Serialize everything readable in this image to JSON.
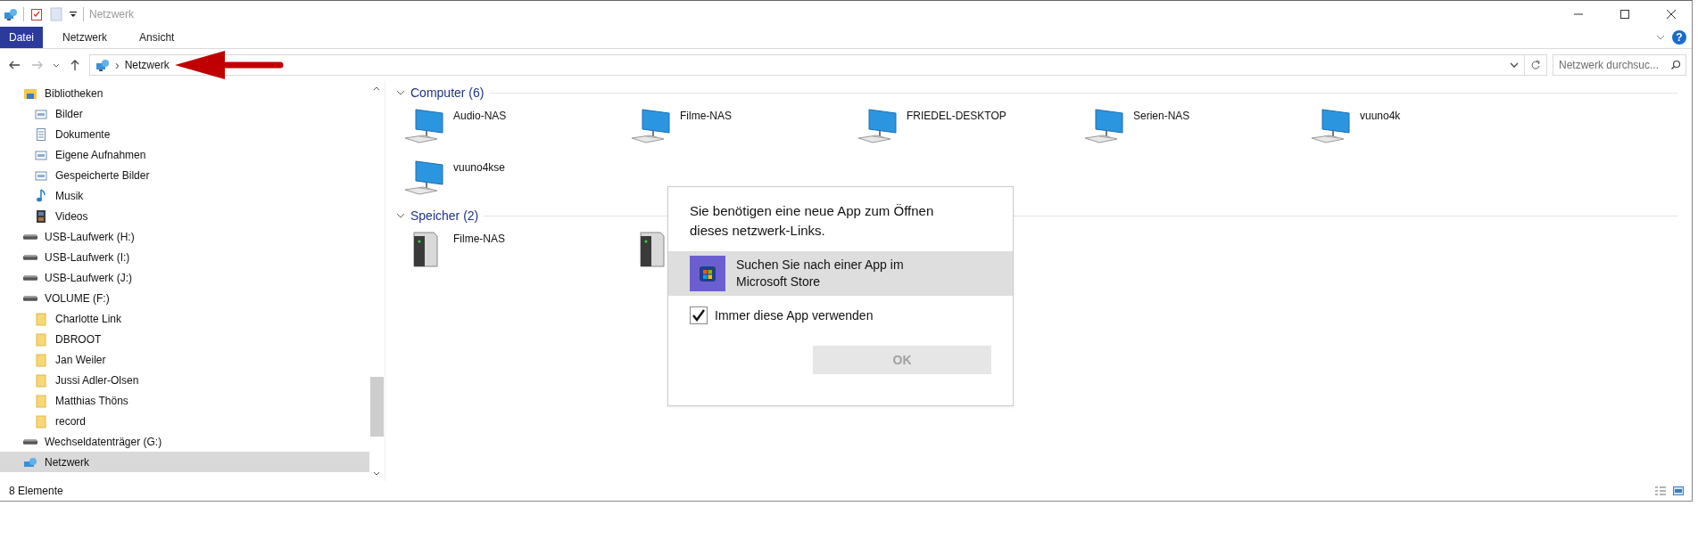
{
  "window": {
    "title": "Netzwerk"
  },
  "ribbon": {
    "tabs": [
      {
        "label": "Datei",
        "selected": true
      },
      {
        "label": "Netzwerk",
        "selected": false
      },
      {
        "label": "Ansicht",
        "selected": false
      }
    ],
    "help_glyph": "?"
  },
  "address": {
    "separator": "›",
    "path": "Netzwerk"
  },
  "search": {
    "placeholder": "Netzwerk durchsuc..."
  },
  "sidebar": {
    "items": [
      {
        "label": "Bibliotheken",
        "kind": "library",
        "selected": false,
        "children": [
          {
            "label": "Bilder",
            "kind": "pictures",
            "selected": false
          },
          {
            "label": "Dokumente",
            "kind": "documents",
            "selected": false
          },
          {
            "label": "Eigene Aufnahmen",
            "kind": "pictures",
            "selected": false
          },
          {
            "label": "Gespeicherte Bilder",
            "kind": "pictures",
            "selected": false
          },
          {
            "label": "Musik",
            "kind": "music",
            "selected": false
          },
          {
            "label": "Videos",
            "kind": "videos",
            "selected": false
          }
        ]
      },
      {
        "label": "USB-Laufwerk (H:)",
        "kind": "drive",
        "selected": false
      },
      {
        "label": "USB-Laufwerk (I:)",
        "kind": "drive",
        "selected": false
      },
      {
        "label": "USB-Laufwerk (J:)",
        "kind": "drive",
        "selected": false
      },
      {
        "label": "VOLUME (F:)",
        "kind": "drive",
        "selected": false,
        "children": [
          {
            "label": "Charlotte Link",
            "kind": "folder",
            "selected": false
          },
          {
            "label": "DBROOT",
            "kind": "folder",
            "selected": false
          },
          {
            "label": "Jan Weiler",
            "kind": "folder",
            "selected": false
          },
          {
            "label": "Jussi Adler-Olsen",
            "kind": "folder",
            "selected": false
          },
          {
            "label": "Matthias Thöns",
            "kind": "folder",
            "selected": false
          },
          {
            "label": "record",
            "kind": "folder",
            "selected": false
          }
        ]
      },
      {
        "label": "Wechseldatenträger (G:)",
        "kind": "drive",
        "selected": false
      },
      {
        "label": "Netzwerk",
        "kind": "network",
        "selected": true
      }
    ]
  },
  "groups": [
    {
      "title": "Computer (6)",
      "items": [
        {
          "name": "Audio-NAS",
          "kind": "computer"
        },
        {
          "name": "Filme-NAS",
          "kind": "computer"
        },
        {
          "name": "FRIEDEL-DESKTOP",
          "kind": "computer"
        },
        {
          "name": "Serien-NAS",
          "kind": "computer"
        },
        {
          "name": "vuuno4k",
          "kind": "computer"
        },
        {
          "name": "vuuno4kse",
          "kind": "computer"
        }
      ]
    },
    {
      "title": "Speicher (2)",
      "items": [
        {
          "name": "Filme-NAS",
          "kind": "storage"
        },
        {
          "kind": "storage"
        }
      ]
    }
  ],
  "dialog": {
    "message": "Sie benötigen eine neue App zum Öffnen dieses netzwerk-Links.",
    "options": [
      {
        "label": "Suchen Sie nach einer App im Microsoft Store",
        "selected": true
      }
    ],
    "checkbox": {
      "label": "Immer diese App verwenden",
      "checked": true
    },
    "button": {
      "label": "OK",
      "disabled": true
    }
  },
  "status_bar": {
    "text": "8 Elemente"
  }
}
